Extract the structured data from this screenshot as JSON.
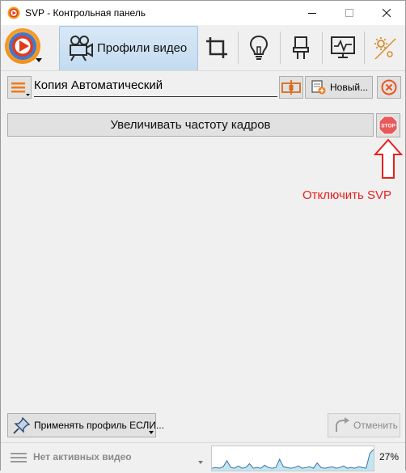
{
  "window": {
    "title": "SVP - Контрольная панель",
    "controls": {
      "minimize": "minimize",
      "maximize": "maximize",
      "close": "close"
    }
  },
  "toolbar": {
    "active_tab_label": "Профили видео",
    "tools": [
      "crop-icon",
      "lightbulb-icon",
      "connector-icon",
      "monitor-icon",
      "settings-gear-icon"
    ]
  },
  "profile": {
    "name": "Копия Автоматический",
    "new_button_label": "Новый..."
  },
  "main": {
    "feature_button_label": "Увеличивать частоту кадров",
    "stop_badge": "STOP",
    "annotation": "Отключить SVP"
  },
  "bottom": {
    "apply_label": "Применять профиль ЕСЛИ...",
    "cancel_label": "Отменить"
  },
  "status": {
    "text": "Нет активных видео",
    "cpu_percent": "27%",
    "cpu_history": [
      2,
      3,
      2,
      4,
      12,
      3,
      2,
      5,
      2,
      3,
      8,
      2,
      3,
      2,
      6,
      3,
      2,
      3,
      14,
      4,
      3,
      2,
      3,
      5,
      2,
      3,
      4,
      2,
      9,
      3,
      2,
      3,
      4,
      2,
      3,
      5,
      2,
      3,
      2,
      4,
      3,
      2,
      22,
      27
    ]
  },
  "colors": {
    "accent": "#e8201c",
    "tab_active": "#c9def2",
    "orange": "#f07a1a",
    "graph_line": "#3a6fa8",
    "graph_fill": "#c2e6ef"
  }
}
